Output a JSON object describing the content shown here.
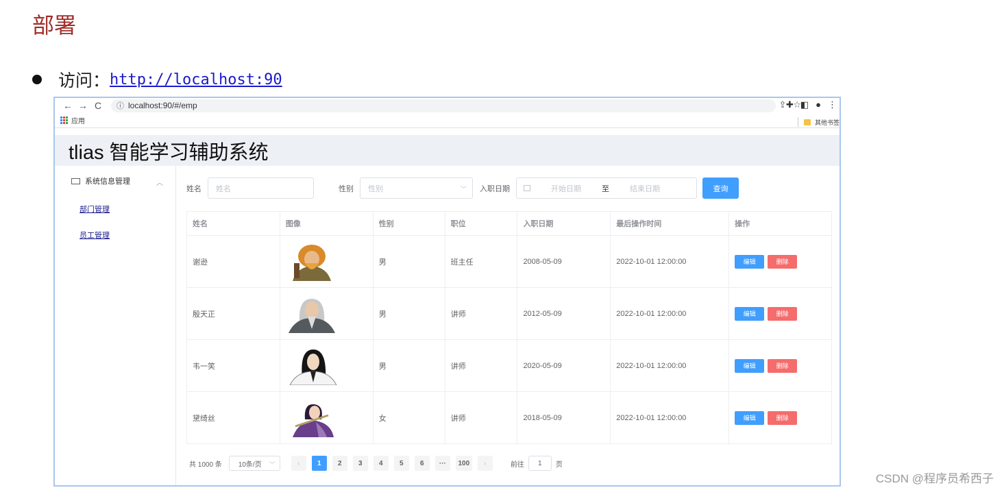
{
  "doc": {
    "heading": "部署",
    "bullet_label": "访问：",
    "bullet_link": "http://localhost:90"
  },
  "browser": {
    "url": "localhost:90/#/emp",
    "bookmark_apps": "应用",
    "bookmark_other": "其他书签"
  },
  "app": {
    "title": "tlias 智能学习辅助系统"
  },
  "sidebar": {
    "group_label": "系统信息管理",
    "items": [
      {
        "label": "部门管理"
      },
      {
        "label": "员工管理"
      }
    ]
  },
  "filter": {
    "name_label": "姓名",
    "name_placeholder": "姓名",
    "gender_label": "性别",
    "gender_placeholder": "性别",
    "date_label": "入职日期",
    "start_placeholder": "开始日期",
    "range_sep": "至",
    "end_placeholder": "结束日期",
    "query_button": "查询"
  },
  "table": {
    "headers": [
      "姓名",
      "图像",
      "性别",
      "职位",
      "入职日期",
      "最后操作时间",
      "操作"
    ],
    "rows": [
      {
        "name": "谢逊",
        "gender": "男",
        "job": "班主任",
        "entry_date": "2008-05-09",
        "update_time": "2022-10-01 12:00:00"
      },
      {
        "name": "殷天正",
        "gender": "男",
        "job": "讲师",
        "entry_date": "2012-05-09",
        "update_time": "2022-10-01 12:00:00"
      },
      {
        "name": "韦一笑",
        "gender": "男",
        "job": "讲师",
        "entry_date": "2020-05-09",
        "update_time": "2022-10-01 12:00:00"
      },
      {
        "name": "黛绮丝",
        "gender": "女",
        "job": "讲师",
        "entry_date": "2018-05-09",
        "update_time": "2022-10-01 12:00:00"
      }
    ],
    "edit_label": "编辑",
    "delete_label": "删除"
  },
  "pager": {
    "total": "共 1000 条",
    "page_size": "10条/页",
    "pages": [
      "1",
      "2",
      "3",
      "4",
      "5",
      "6",
      "···",
      "100"
    ],
    "current_page": "1",
    "goto_prefix": "前往",
    "goto_value": "1",
    "goto_suffix": "页"
  },
  "watermark": "CSDN @程序员希西子"
}
